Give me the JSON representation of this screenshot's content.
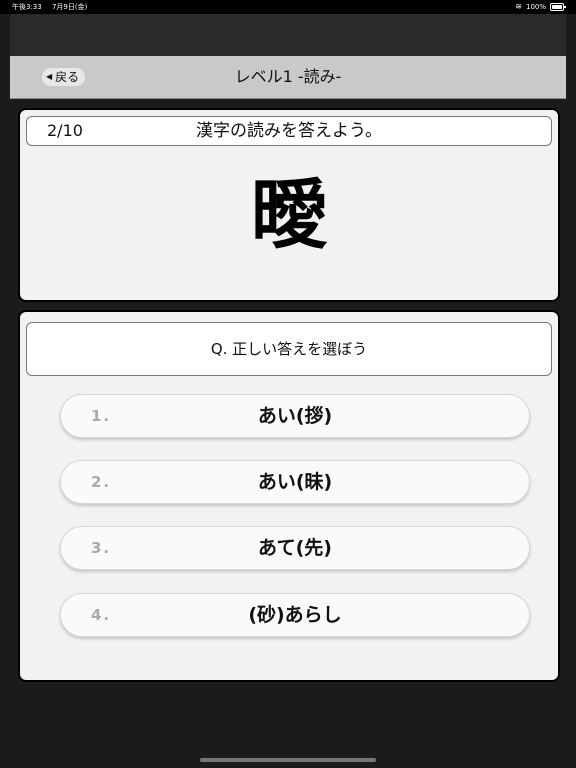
{
  "status_bar": {
    "time": "午後3:33",
    "date": "7月9日(金)",
    "battery": "100%"
  },
  "nav": {
    "back_label": "戻る",
    "title": "レベル1 -読み-"
  },
  "question": {
    "progress": "2/10",
    "instruction": "漢字の読みを答えよう。",
    "kanji": "曖"
  },
  "answers": {
    "prompt": "Q. 正しい答えを選ぼう",
    "choices": [
      {
        "number": "1.",
        "text": "あい(拶)"
      },
      {
        "number": "2.",
        "text": "あい(昧)"
      },
      {
        "number": "3.",
        "text": "あて(先)"
      },
      {
        "number": "4.",
        "text": "(砂)あらし"
      }
    ]
  }
}
